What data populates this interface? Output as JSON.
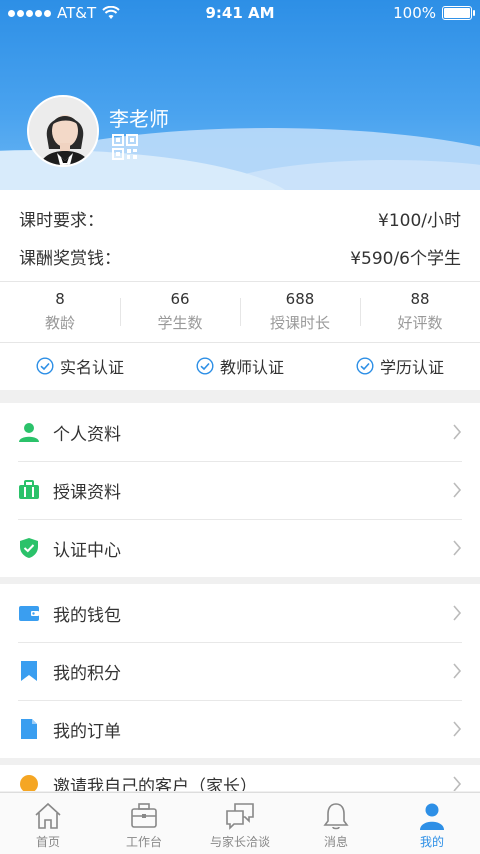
{
  "status_bar": {
    "carrier": "AT&T",
    "time": "9:41 AM",
    "battery": "100%"
  },
  "profile": {
    "name": "李老师"
  },
  "info": {
    "hour_requirement": {
      "label": "课时要求：",
      "value": "¥100/小时"
    },
    "reward": {
      "label": "课酬奖赏钱：",
      "value": "¥590/6个学生"
    }
  },
  "stats": [
    {
      "value": "8",
      "label": "教龄"
    },
    {
      "value": "66",
      "label": "学生数"
    },
    {
      "value": "688",
      "label": "授课时长"
    },
    {
      "value": "88",
      "label": "好评数"
    }
  ],
  "certifications": [
    "实名认证",
    "教师认证",
    "学历认证"
  ],
  "menu": {
    "group1": [
      {
        "label": "个人资料",
        "icon": "person-icon"
      },
      {
        "label": "授课资料",
        "icon": "briefcase-icon"
      },
      {
        "label": "认证中心",
        "icon": "shield-check-icon"
      }
    ],
    "group2": [
      {
        "label": "我的钱包",
        "icon": "wallet-icon"
      },
      {
        "label": "我的积分",
        "icon": "bookmark-icon"
      },
      {
        "label": "我的订单",
        "icon": "document-icon"
      }
    ],
    "group3": [
      {
        "label": "邀请我自己的客户（家长）",
        "icon": "invite-icon"
      }
    ]
  },
  "tabbar": [
    {
      "label": "首页",
      "icon": "home-icon"
    },
    {
      "label": "工作台",
      "icon": "briefcase-icon"
    },
    {
      "label": "与家长洽谈",
      "icon": "chat-icon"
    },
    {
      "label": "消息",
      "icon": "bell-icon"
    },
    {
      "label": "我的",
      "icon": "user-icon",
      "active": true
    }
  ],
  "colors": {
    "primary": "#2d8fe6",
    "green": "#2bc26a",
    "blue_icon": "#3a9ef0"
  }
}
